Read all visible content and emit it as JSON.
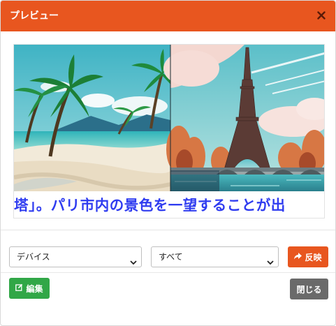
{
  "dialog": {
    "title": "プレビュー",
    "close_icon": "close-icon"
  },
  "preview": {
    "left_image": "tropical-beach-illustration",
    "right_image": "eiffel-tower-paris-illustration",
    "scroll_text": "塔」。パリ市内の景色を一望することが出"
  },
  "controls": {
    "device_select": {
      "value": "デバイス",
      "icon": "chevron-down-icon"
    },
    "all_select": {
      "value": "すべて",
      "icon": "chevron-down-icon"
    },
    "apply_button": {
      "label": "反映",
      "icon": "share-arrow-icon"
    }
  },
  "footer": {
    "edit_button": {
      "label": "編集",
      "icon": "edit-icon"
    },
    "close_button": {
      "label": "閉じる"
    }
  },
  "colors": {
    "header": "#e8561f",
    "apply": "#e8561f",
    "edit": "#31a747",
    "close": "#6a6a6a",
    "scroll_text": "#2f3cf0"
  }
}
